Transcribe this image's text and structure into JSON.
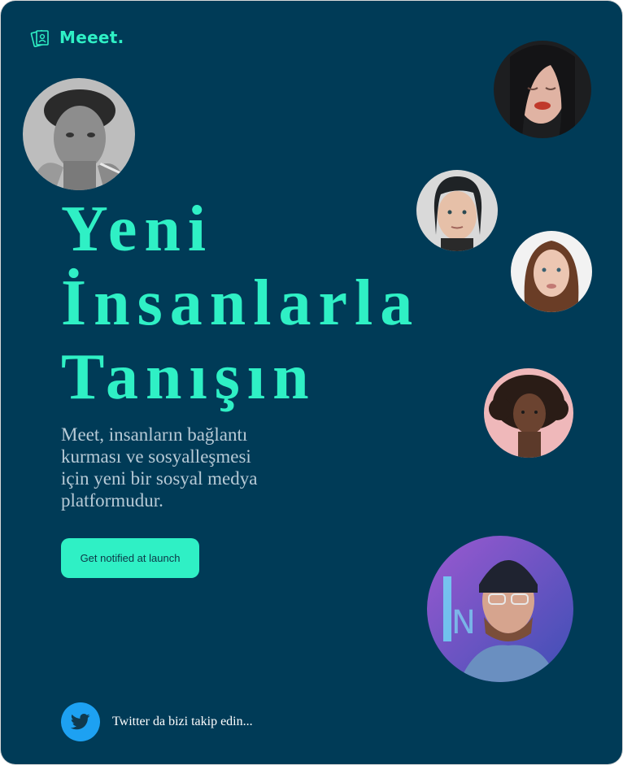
{
  "brand": {
    "name": "Meeet.",
    "icon": "photo-stack-icon",
    "accent": "#2ff0c5"
  },
  "hero": {
    "title_lines": [
      "Yeni",
      "İnsanlarla",
      "Tanışın"
    ],
    "description": "Meet, insanların bağlantı kurması ve sosyalleşmesi için yeni bir sosyal medya platformudur.",
    "cta_label": "Get notified at launch"
  },
  "social": {
    "twitter_text": "Twitter da bizi takip edin...",
    "icon": "twitter-bird-icon",
    "twitter_color": "#1da1f2"
  },
  "colors": {
    "background": "#003b57",
    "accent": "#2ff0c5",
    "text_muted": "#b7cad6"
  },
  "avatars": [
    "avatar-man-monochrome",
    "avatar-woman-dark-hair",
    "avatar-woman-bangs",
    "avatar-woman-brown-hair",
    "avatar-woman-curly-hair",
    "avatar-man-beanie-neon"
  ]
}
